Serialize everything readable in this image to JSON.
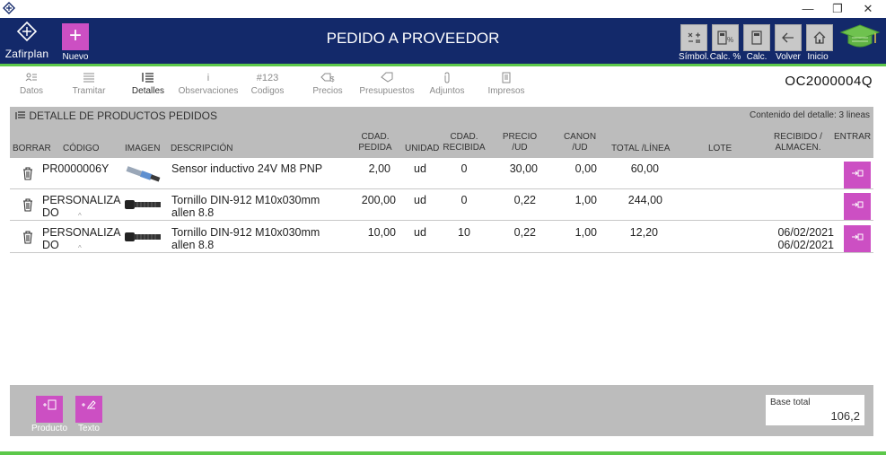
{
  "window": {
    "minimize": "—",
    "restore": "❐",
    "close": "✕"
  },
  "topbar": {
    "logo_name": "Zafirplan",
    "new_label": "Nuevo",
    "title": "PEDIDO A PROVEEDOR",
    "tools": [
      {
        "label": "Símbol.",
        "icon": "symbols-icon"
      },
      {
        "label": "Calc. %",
        "icon": "calc-percent-icon"
      },
      {
        "label": "Calc.",
        "icon": "calculator-icon"
      },
      {
        "label": "Volver",
        "icon": "back-arrow-icon"
      },
      {
        "label": "Inicio",
        "icon": "home-icon"
      }
    ]
  },
  "tabs": [
    {
      "label": "Datos",
      "icon": "user-card-icon"
    },
    {
      "label": "Tramitar",
      "icon": "list-icon"
    },
    {
      "label": "Detalles",
      "icon": "details-list-icon",
      "active": true
    },
    {
      "label": "Observaciones",
      "icon": "info-icon"
    },
    {
      "label": "Codigos",
      "icon": "#123"
    },
    {
      "label": "Precios",
      "icon": "price-tag-icon"
    },
    {
      "label": "Presupuestos",
      "icon": "tag-icon"
    },
    {
      "label": "Adjuntos",
      "icon": "paperclip-icon"
    },
    {
      "label": "Impresos",
      "icon": "document-icon"
    }
  ],
  "order_number": "OC2000004Q",
  "detail": {
    "title": "DETALLE DE PRODUCTOS PEDIDOS",
    "count": "Contenido del detalle: 3 lineas",
    "columns": {
      "borrar": "BORRAR",
      "codigo": "CÓDIGO",
      "imagen": "IMAGEN",
      "descripcion": "DESCRIPCIÓN",
      "cdad_pedida_1": "CDAD.",
      "cdad_pedida_2": "PEDIDA",
      "unidad": "UNIDAD",
      "cdad_recibida_1": "CDAD.",
      "cdad_recibida_2": "RECIBIDA",
      "precio_1": "PRECIO",
      "precio_2": "/UD",
      "canon_1": "CANON",
      "canon_2": "/UD",
      "total": "TOTAL /LÍNEA",
      "lote": "LOTE",
      "recibido_1": "RECIBIDO /",
      "recibido_2": "ALMACEN.",
      "entrar": "ENTRAR"
    },
    "rows": [
      {
        "code_1": "PR0000006Y",
        "code_2": "",
        "desc_1": "Sensor inductivo 24V M8 PNP",
        "desc_2": "",
        "pedida": "2,00",
        "unidad": "ud",
        "recibida": "0",
        "precio": "30,00",
        "canon": "0,00",
        "total": "60,00",
        "lote": "",
        "recibido": "",
        "almacen": ""
      },
      {
        "code_1": "PERSONALIZA",
        "code_2": "DO",
        "desc_1": "Tornillo DIN-912 M10x030mm",
        "desc_2": "allen 8.8",
        "pedida": "200,00",
        "unidad": "ud",
        "recibida": "0",
        "precio": "0,22",
        "canon": "1,00",
        "total": "244,00",
        "lote": "",
        "recibido": "",
        "almacen": ""
      },
      {
        "code_1": "PERSONALIZA",
        "code_2": "DO",
        "desc_1": "Tornillo DIN-912 M10x030mm",
        "desc_2": "allen 8.8",
        "pedida": "10,00",
        "unidad": "ud",
        "recibida": "10",
        "precio": "0,22",
        "canon": "1,00",
        "total": "12,20",
        "lote": "",
        "recibido": "06/02/2021",
        "almacen": "06/02/2021"
      }
    ]
  },
  "footer": {
    "producto_label": "Producto",
    "texto_label": "Texto",
    "base_label": "Base total",
    "base_value": "106,2"
  },
  "colors": {
    "navy": "#13296a",
    "magenta": "#cc4fc3",
    "green": "#5cc84a",
    "gray": "#bcbcbc"
  }
}
